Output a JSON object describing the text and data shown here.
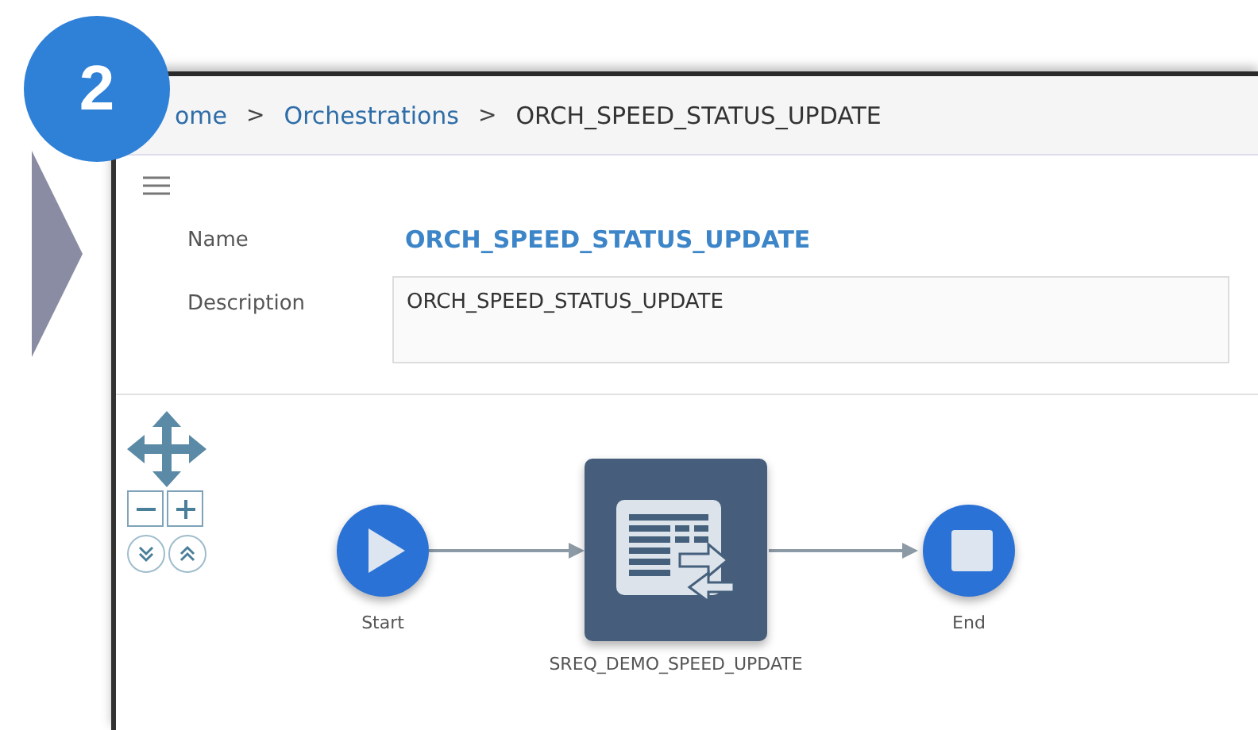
{
  "step_badge": "2",
  "breadcrumbs": [
    {
      "label": "ome",
      "kind": "link"
    },
    {
      "label": "Orchestrations",
      "kind": "link"
    },
    {
      "label": "ORCH_SPEED_STATUS_UPDATE",
      "kind": "current"
    }
  ],
  "breadcrumb_separator": ">",
  "form": {
    "name_label": "Name",
    "name_value": "ORCH_SPEED_STATUS_UPDATE",
    "description_label": "Description",
    "description_value": "ORCH_SPEED_STATUS_UPDATE"
  },
  "diagram": {
    "nodes": [
      {
        "kind": "start",
        "label": "Start"
      },
      {
        "kind": "task",
        "label": "SREQ_DEMO_SPEED_UPDATE"
      },
      {
        "kind": "end",
        "label": "End"
      }
    ]
  }
}
